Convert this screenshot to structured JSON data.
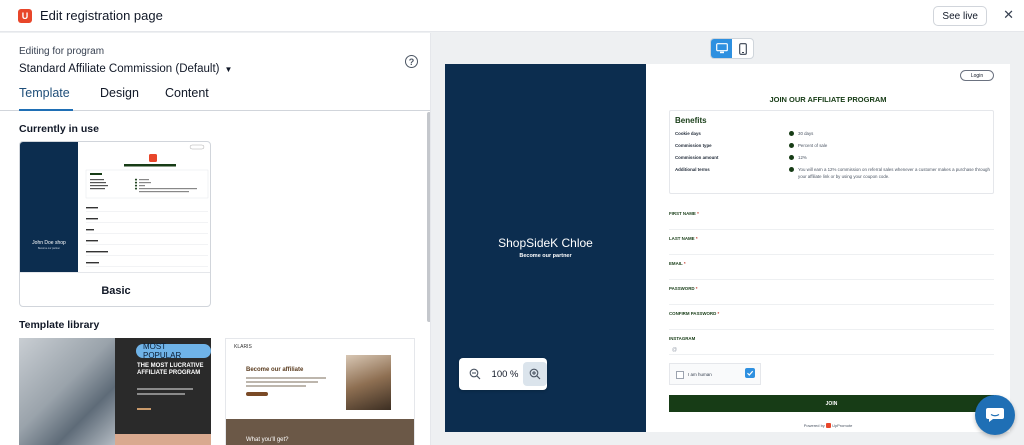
{
  "app": {
    "title": "Edit registration page",
    "see_live_label": "See live"
  },
  "editor": {
    "program_label": "Editing for program",
    "program_value": "Standard Affiliate Commission (Default)",
    "tabs": [
      {
        "label": "Template",
        "active": true
      },
      {
        "label": "Design",
        "active": false
      },
      {
        "label": "Content",
        "active": false
      }
    ],
    "currently_in_use_title": "Currently in use",
    "basic_card": {
      "name": "Basic",
      "shop_name": "John Doe shop",
      "tagline": "Become our partner"
    },
    "library_title": "Template library",
    "library": [
      {
        "badge": "MOST POPULAR",
        "heading": "THE MOST LUCRATIVE AFFILIATE PROGRAM"
      },
      {
        "brand": "KLARIS",
        "heading": "Become our affiliate",
        "footer": "What you'll get?"
      }
    ]
  },
  "device_toggle": {
    "active": "desktop"
  },
  "preview": {
    "shop_name": "ShopSideK Chloe",
    "tagline": "Become our partner",
    "login_label": "Login",
    "join_title": "JOIN OUR AFFILIATE PROGRAM",
    "benefits_title": "Benefits",
    "benefits": [
      {
        "label": "Cookie days",
        "value": "30 days"
      },
      {
        "label": "Commission type",
        "value": "Percent of sale"
      },
      {
        "label": "Commission amount",
        "value": "12%"
      },
      {
        "label": "Additional terms",
        "value": "You will earn a 12% commission on referral sales whenever a customer makes a purchase through your affiliate link or by using your coupon code."
      }
    ],
    "fields": [
      {
        "label": "FIRST NAME",
        "required": true
      },
      {
        "label": "LAST NAME",
        "required": true
      },
      {
        "label": "EMAIL",
        "required": true
      },
      {
        "label": "PASSWORD",
        "required": true
      },
      {
        "label": "CONFIRM PASSWORD",
        "required": true
      },
      {
        "label": "INSTAGRAM",
        "required": false
      }
    ],
    "instagram_prefix": "@",
    "captcha_label": "I am human",
    "join_button": "JOIN",
    "powered_by": "Powered by",
    "powered_brand": "UpPromote"
  },
  "zoom": {
    "value": "100 %"
  },
  "colors": {
    "brand_orange": "#e8462a",
    "navy": "#0c2d4f",
    "forest_green": "#173c16",
    "accent_blue": "#2e90e0"
  },
  "icons": [
    "app-logo-icon",
    "caret-down-icon",
    "help-icon",
    "close-icon",
    "desktop-icon",
    "mobile-icon",
    "zoom-out-icon",
    "zoom-in-icon",
    "check-circle-icon",
    "captcha-logo-icon",
    "chat-icon"
  ]
}
